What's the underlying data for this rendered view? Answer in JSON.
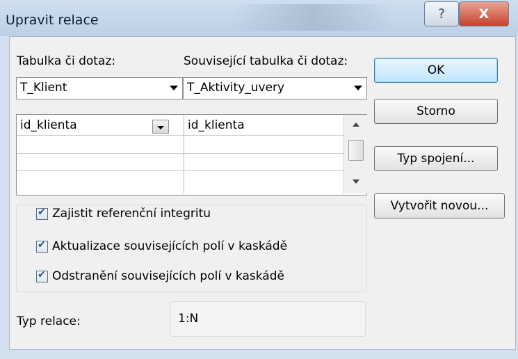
{
  "window": {
    "title": "Upravit relace",
    "help_glyph": "?",
    "close_glyph": "X"
  },
  "labels": {
    "table_or_query": "Tabulka či dotaz:",
    "related_table": "Související tabulka či dotaz:",
    "relation_type": "Typ relace:"
  },
  "combos": {
    "table_value": "T_Klient",
    "related_value": "T_Aktivity_uvery"
  },
  "grid": {
    "rows": [
      {
        "left": "id_klienta",
        "right": "id_klienta"
      },
      {
        "left": "",
        "right": ""
      },
      {
        "left": "",
        "right": ""
      },
      {
        "left": "",
        "right": ""
      }
    ]
  },
  "options": {
    "referential_integrity": {
      "label": "Zajistit referenční integritu",
      "checked": true
    },
    "cascade_update": {
      "label": "Aktualizace souvisejících polí v kaskádě",
      "checked": true
    },
    "cascade_delete": {
      "label": "Odstranění souvisejících polí v kaskádě",
      "checked": true
    }
  },
  "relation_type_value": "1:N",
  "buttons": {
    "ok": "OK",
    "cancel": "Storno",
    "join_type": "Typ spojení...",
    "create_new": "Vytvořit novou..."
  }
}
